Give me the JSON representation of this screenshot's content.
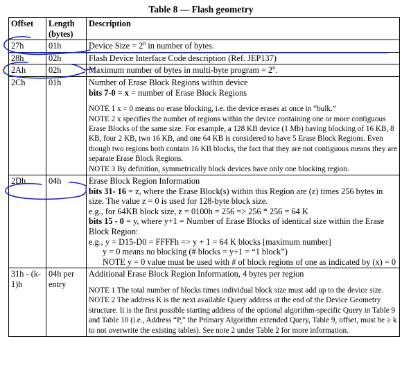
{
  "title": "Table 8 — Flash geometry",
  "headers": {
    "offset": "Offset",
    "length": "Length (bytes)",
    "description": "Description"
  },
  "rows": {
    "r27": {
      "offset": "27h",
      "length": "01h",
      "desc_pre": "Device Size = 2",
      "desc_sup": "n",
      "desc_post": " in number of bytes."
    },
    "r28": {
      "offset": "28h",
      "length": "02h",
      "desc": "Flash Device Interface Code description  (Ref. JEP137)"
    },
    "r2a": {
      "offset": "2Ah",
      "length": "02h",
      "desc_pre": "Maximum number of bytes in multi-byte program = 2",
      "desc_sup": "n",
      "desc_post": "."
    },
    "r2c": {
      "offset": "2Ch",
      "length": "01h",
      "line1": "Number of Erase Block Regions within device",
      "line2_bold": "bits 7-0 = x",
      "line2_rest": " = number of Erase Block Regions",
      "note1": "NOTE 1   x = 0 means no erase blocking, i.e. the device erases at once in “bulk.”",
      "note2": "NOTE 2   x specifies the number of regions within the device containing one or more contiguous Erase Blocks of the same size. For example, a 128 KB device (1 Mb) having blocking of 16 KB, 8 KB, four 2 KB, two 16 KB, and one 64 KB is considered to have 5 Erase Block Regions.  Even though two regions both contain 16 KB blocks, the fact that they are not contiguous means they are separate Erase Block Regions.",
      "note3": "NOTE 3   By definition, symmetrically block devices have only one blocking region."
    },
    "r2d": {
      "offset": "2Dh",
      "length": "04h",
      "line1": "Erase Block Region Information",
      "line2_bold": "bits 31- 16",
      "line2_rest": " = z,  where the Erase Block(s) within this Region are (z) times 256 bytes in size.  The value z = 0 is used for 128-byte block size.",
      "line3": "e.g.,  for 64KB block size, z = 0100h = 256  =>  256 * 256 = 64 K",
      "line4_bold": "bits 15 - 0",
      "line4_rest": " = y, where y+1 = Number of Erase Blocks of identical size within the Erase Block Region:",
      "line5": "e.g., y = D15-D0 = FFFFh => y + 1 = 64 K blocks [maximum number]",
      "line6": "y = 0 means no blocking (# blocks = y+1 = “1 block”)",
      "line7": "NOTE    y = 0 value must be used with # of block regions of one as indicated by (x) = 0"
    },
    "r31": {
      "offset": "31h - (k-1)h",
      "length": "04h per entry",
      "line1": "Additional Erase Block Region Information, 4 bytes per region",
      "note1": "NOTE 1   The total number of blocks times individual block size must add up to the device size.",
      "note2": "NOTE 2   The address K is the next available Query address at the end of the Device Geometry structure.  It is the first possible starting address of the optional algorithm-specific Query in Table 9 and Table 10 (i.e., Address “P,” the Primary Algorithm extended Query, Table 9, offset, must be ≥ k to not overwrite the existing tables). See note 2 under Table 2 for more information."
    }
  },
  "annotation_color": "#1a28c8"
}
